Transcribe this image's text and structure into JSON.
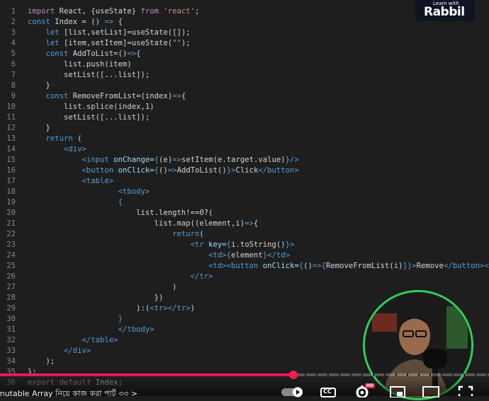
{
  "logo": {
    "small_text": "Learn with",
    "big_text": "Rabbil"
  },
  "code_lines": [
    {
      "n": "1",
      "tokens": [
        {
          "t": "import",
          "c": "ctl"
        },
        {
          "t": " React, {useState} "
        },
        {
          "t": "from",
          "c": "ctl"
        },
        {
          "t": " "
        },
        {
          "t": "'react'",
          "c": "str"
        },
        {
          "t": ";"
        }
      ]
    },
    {
      "n": "2",
      "tokens": [
        {
          "t": "const",
          "c": "kw"
        },
        {
          "t": " Index = () "
        },
        {
          "t": "=>",
          "c": "kw"
        },
        {
          "t": " {"
        }
      ]
    },
    {
      "n": "3",
      "tokens": [
        {
          "t": "    "
        },
        {
          "t": "let",
          "c": "kw"
        },
        {
          "t": " [list,setList]=useState([]);"
        }
      ]
    },
    {
      "n": "4",
      "tokens": [
        {
          "t": "    "
        },
        {
          "t": "let",
          "c": "kw"
        },
        {
          "t": " [item,setItem]=useState("
        },
        {
          "t": "\"\"",
          "c": "str"
        },
        {
          "t": ");"
        }
      ]
    },
    {
      "n": "5",
      "tokens": [
        {
          "t": "    "
        },
        {
          "t": "const",
          "c": "kw"
        },
        {
          "t": " AddToList=()"
        },
        {
          "t": "=>",
          "c": "kw"
        },
        {
          "t": "{"
        }
      ]
    },
    {
      "n": "6",
      "tokens": [
        {
          "t": "        list.push(item)"
        }
      ]
    },
    {
      "n": "7",
      "tokens": [
        {
          "t": "        setList([...list]);"
        }
      ]
    },
    {
      "n": "8",
      "tokens": [
        {
          "t": "    }"
        }
      ]
    },
    {
      "n": "9",
      "tokens": [
        {
          "t": "    "
        },
        {
          "t": "const",
          "c": "kw"
        },
        {
          "t": " RemoveFromList=(index)"
        },
        {
          "t": "=>",
          "c": "kw"
        },
        {
          "t": "{"
        }
      ]
    },
    {
      "n": "10",
      "tokens": [
        {
          "t": "        list.splice(index,1)"
        }
      ]
    },
    {
      "n": "11",
      "tokens": [
        {
          "t": "        setList([...list]);"
        }
      ]
    },
    {
      "n": "12",
      "tokens": [
        {
          "t": "    }"
        }
      ]
    },
    {
      "n": "13",
      "tokens": [
        {
          "t": "    "
        },
        {
          "t": "return",
          "c": "kw"
        },
        {
          "t": " ("
        }
      ]
    },
    {
      "n": "14",
      "tokens": [
        {
          "t": "        "
        },
        {
          "t": "<div>",
          "c": "tag"
        }
      ]
    },
    {
      "n": "15",
      "tokens": [
        {
          "t": "            "
        },
        {
          "t": "<input",
          "c": "tag"
        },
        {
          "t": " "
        },
        {
          "t": "onChange",
          "c": "attr"
        },
        {
          "t": "="
        },
        {
          "t": "{",
          "c": "kw"
        },
        {
          "t": "(e)"
        },
        {
          "t": "=>",
          "c": "kw"
        },
        {
          "t": "setItem(e.target.value)"
        },
        {
          "t": "}",
          "c": "kw"
        },
        {
          "t": "/>",
          "c": "tag"
        }
      ]
    },
    {
      "n": "16",
      "tokens": [
        {
          "t": "            "
        },
        {
          "t": "<button",
          "c": "tag"
        },
        {
          "t": " "
        },
        {
          "t": "onClick",
          "c": "attr"
        },
        {
          "t": "="
        },
        {
          "t": "{",
          "c": "kw"
        },
        {
          "t": "()"
        },
        {
          "t": "=>",
          "c": "kw"
        },
        {
          "t": "AddToList()"
        },
        {
          "t": "}",
          "c": "kw"
        },
        {
          "t": ">",
          "c": "tag"
        },
        {
          "t": "Click"
        },
        {
          "t": "</button>",
          "c": "tag"
        }
      ]
    },
    {
      "n": "17",
      "tokens": [
        {
          "t": "            "
        },
        {
          "t": "<table>",
          "c": "tag"
        }
      ]
    },
    {
      "n": "18",
      "tokens": [
        {
          "t": "                    "
        },
        {
          "t": "<tbody>",
          "c": "tag"
        }
      ]
    },
    {
      "n": "19",
      "tokens": [
        {
          "t": "                    "
        },
        {
          "t": "{",
          "c": "kw"
        }
      ]
    },
    {
      "n": "20",
      "tokens": [
        {
          "t": "                        list.length!==0?("
        }
      ]
    },
    {
      "n": "21",
      "tokens": [
        {
          "t": "                            list.map((element,i)"
        },
        {
          "t": "=>",
          "c": "kw"
        },
        {
          "t": "{"
        }
      ]
    },
    {
      "n": "22",
      "tokens": [
        {
          "t": "                                "
        },
        {
          "t": "return",
          "c": "kw"
        },
        {
          "t": "("
        }
      ]
    },
    {
      "n": "23",
      "tokens": [
        {
          "t": "                                    "
        },
        {
          "t": "<tr",
          "c": "tag"
        },
        {
          "t": " "
        },
        {
          "t": "key",
          "c": "attr"
        },
        {
          "t": "="
        },
        {
          "t": "{",
          "c": "kw"
        },
        {
          "t": "i.toString()"
        },
        {
          "t": "}",
          "c": "kw"
        },
        {
          "t": ">",
          "c": "tag"
        }
      ]
    },
    {
      "n": "24",
      "tokens": [
        {
          "t": "                                        "
        },
        {
          "t": "<td>",
          "c": "tag"
        },
        {
          "t": "{",
          "c": "kw"
        },
        {
          "t": "element"
        },
        {
          "t": "}",
          "c": "kw"
        },
        {
          "t": "</td>",
          "c": "tag"
        }
      ]
    },
    {
      "n": "25",
      "tokens": [
        {
          "t": "                                        "
        },
        {
          "t": "<td>",
          "c": "tag"
        },
        {
          "t": "<button",
          "c": "tag"
        },
        {
          "t": " "
        },
        {
          "t": "onClick",
          "c": "attr"
        },
        {
          "t": "="
        },
        {
          "t": "{",
          "c": "kw"
        },
        {
          "t": "()"
        },
        {
          "t": "=>",
          "c": "kw"
        },
        {
          "t": "{",
          "c": "kw"
        },
        {
          "t": "RemoveFromList(i)"
        },
        {
          "t": "}",
          "c": "kw"
        },
        {
          "t": "}",
          "c": "kw"
        },
        {
          "t": ">",
          "c": "tag"
        },
        {
          "t": "Remove"
        },
        {
          "t": "</button>",
          "c": "tag"
        },
        {
          "t": "</td>",
          "c": "tag"
        }
      ]
    },
    {
      "n": "26",
      "tokens": [
        {
          "t": "                                    "
        },
        {
          "t": "</tr>",
          "c": "tag"
        }
      ]
    },
    {
      "n": "27",
      "tokens": [
        {
          "t": "                                )"
        }
      ]
    },
    {
      "n": "28",
      "tokens": [
        {
          "t": "                            })"
        }
      ]
    },
    {
      "n": "29",
      "tokens": [
        {
          "t": "                        ):("
        },
        {
          "t": "<tr></tr>",
          "c": "tag"
        },
        {
          "t": ")"
        }
      ]
    },
    {
      "n": "30",
      "tokens": [
        {
          "t": "                    "
        },
        {
          "t": "}",
          "c": "kw"
        }
      ]
    },
    {
      "n": "31",
      "tokens": [
        {
          "t": "                    "
        },
        {
          "t": "</tbody>",
          "c": "tag"
        }
      ]
    },
    {
      "n": "32",
      "tokens": [
        {
          "t": "            "
        },
        {
          "t": "</table>",
          "c": "tag"
        }
      ]
    },
    {
      "n": "33",
      "tokens": [
        {
          "t": "        "
        },
        {
          "t": "</div>",
          "c": "tag"
        }
      ]
    },
    {
      "n": "34",
      "tokens": [
        {
          "t": "    );"
        }
      ]
    },
    {
      "n": "35",
      "tokens": [
        {
          "t": "};"
        }
      ]
    },
    {
      "n": "36",
      "tokens": [
        {
          "t": "export",
          "c": "ctl"
        },
        {
          "t": " "
        },
        {
          "t": "default",
          "c": "ctl"
        },
        {
          "t": " Index;"
        }
      ]
    }
  ],
  "video": {
    "title": "mutable Array নিয়ে কাজ করা পার্ট ৩৩ >",
    "progress": 0.6
  },
  "controls": {
    "autoplay_icon": "autoplay-toggle-icon",
    "cc_label": "CC",
    "hd_badge": "HD",
    "settings_icon": "gear-icon",
    "miniplayer_icon": "miniplayer-icon",
    "theater_icon": "theater-mode-icon",
    "fullscreen_icon": "fullscreen-icon"
  },
  "colors": {
    "progress": "#e41b52",
    "webcam_border": "#2fd15a"
  }
}
